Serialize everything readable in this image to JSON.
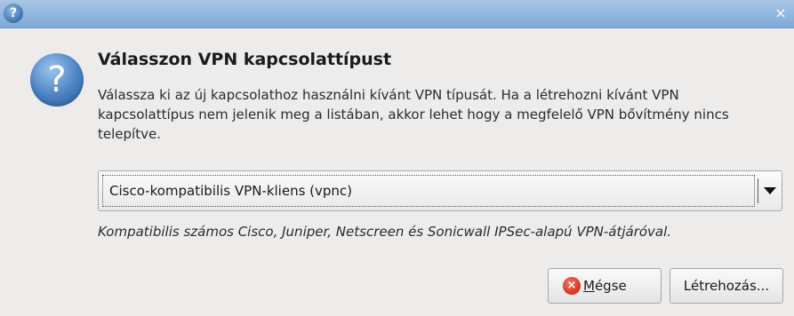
{
  "titlebar": {
    "help_glyph": "?",
    "close_glyph": "×"
  },
  "icons": {
    "dialog": "question-icon",
    "cancel": "cancel-icon"
  },
  "dialog": {
    "heading": "Válasszon VPN kapcsolattípust",
    "description": "Válassza ki az új kapcsolathoz használni kívánt VPN típusát. Ha a létrehozni kívánt VPN kapcsolattípus nem jelenik meg a listában, akkor lehet hogy a megfelelő VPN bővítmény nincs telepítve.",
    "big_icon_glyph": "?",
    "vpn_type": {
      "selected": "Cisco-kompatibilis VPN-kliens (vpnc)"
    },
    "vpn_type_description": "Kompatibilis számos Cisco, Juniper, Netscreen és Sonicwall IPSec-alapú VPN-átjáróval."
  },
  "buttons": {
    "cancel_icon_glyph": "×",
    "cancel_mnemonic": "M",
    "cancel_rest": "égse",
    "create_label": "Létrehozás..."
  },
  "colors": {
    "titlebar": "#7da9d6",
    "window_bg": "#edeceb",
    "cancel_icon": "#d93a25",
    "help_icon": "#4a82c2"
  }
}
